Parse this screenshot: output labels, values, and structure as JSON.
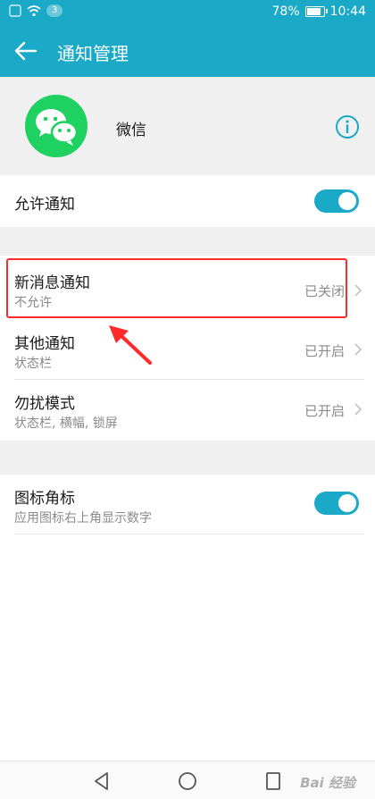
{
  "status_bar": {
    "sim_label": "3",
    "battery": "78%",
    "battery_level": 0.78,
    "time": "10:44"
  },
  "app_bar": {
    "title": "通知管理"
  },
  "app_header": {
    "name": "微信"
  },
  "settings": {
    "allow": {
      "title": "允许通知",
      "on": true
    },
    "new_message": {
      "title": "新消息通知",
      "subtitle": "不允许",
      "value": "已关闭"
    },
    "other": {
      "title": "其他通知",
      "subtitle": "状态栏",
      "value": "已开启"
    },
    "dnd": {
      "title": "勿扰模式",
      "subtitle": "状态栏, 横幅, 锁屏",
      "value": "已开启"
    },
    "badge": {
      "title": "图标角标",
      "subtitle": "应用图标右上角显示数字",
      "on": true
    }
  },
  "watermark": "Bai 经验",
  "colors": {
    "accent": "#1aa9c6",
    "highlight": "#ff2a2a",
    "wechat": "#1fd161"
  }
}
